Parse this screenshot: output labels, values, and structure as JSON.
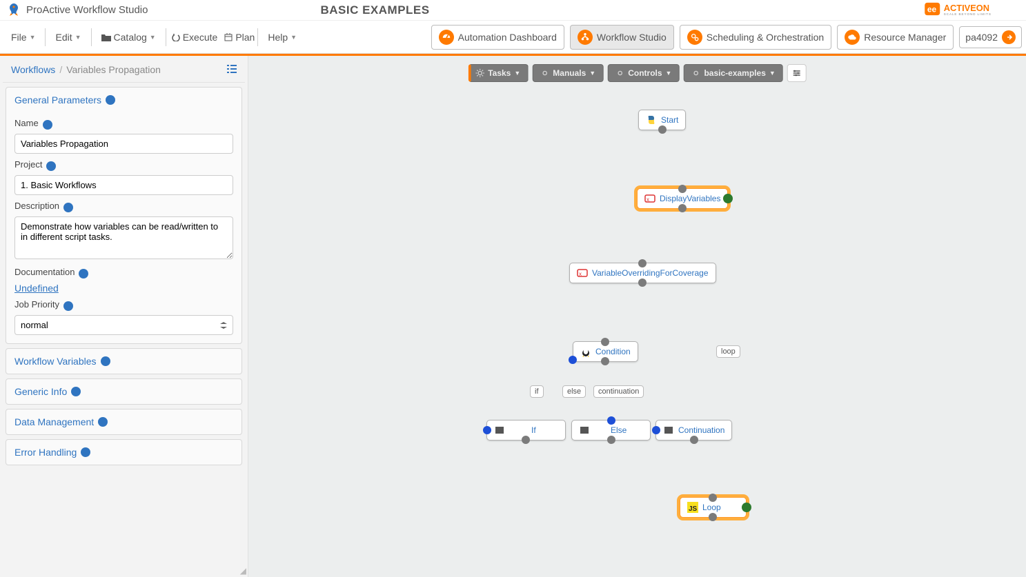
{
  "header": {
    "title": "ProActive Workflow Studio",
    "center_title": "BASIC EXAMPLES",
    "brand": "ACTIVEON",
    "brand_sub": "SCALE BEYOND LIMITS"
  },
  "menu": {
    "file": "File",
    "edit": "Edit",
    "catalog": "Catalog",
    "execute": "Execute",
    "plan": "Plan",
    "help": "Help"
  },
  "nav": {
    "automation": "Automation Dashboard",
    "studio": "Workflow Studio",
    "scheduling": "Scheduling & Orchestration",
    "resource": "Resource Manager",
    "user": "pa4092"
  },
  "crumbs": {
    "root": "Workflows",
    "current": "Variables Propagation"
  },
  "general": {
    "section": "General Parameters",
    "name_label": "Name",
    "name_value": "Variables Propagation",
    "project_label": "Project",
    "project_value": "1. Basic Workflows",
    "desc_label": "Description",
    "desc_value": "Demonstrate how variables can be read/written to in different script tasks.",
    "doc_label": "Documentation",
    "doc_value": "Undefined",
    "priority_label": "Job Priority",
    "priority_value": "normal"
  },
  "sections": {
    "workflow_vars": "Workflow Variables",
    "generic_info": "Generic Info",
    "data_mgmt": "Data Management",
    "error_handling": "Error Handling"
  },
  "canvas_toolbar": {
    "tasks": "Tasks",
    "manuals": "Manuals",
    "controls": "Controls",
    "examples": "basic-examples"
  },
  "nodes": {
    "start": "Start",
    "display": "DisplayVariables",
    "override": "VariableOverridingForCoverage",
    "condition": "Condition",
    "if": "If",
    "else": "Else",
    "cont": "Continuation",
    "loop": "Loop"
  },
  "branch_labels": {
    "if": "if",
    "else": "else",
    "cont": "continuation",
    "loop": "loop"
  }
}
